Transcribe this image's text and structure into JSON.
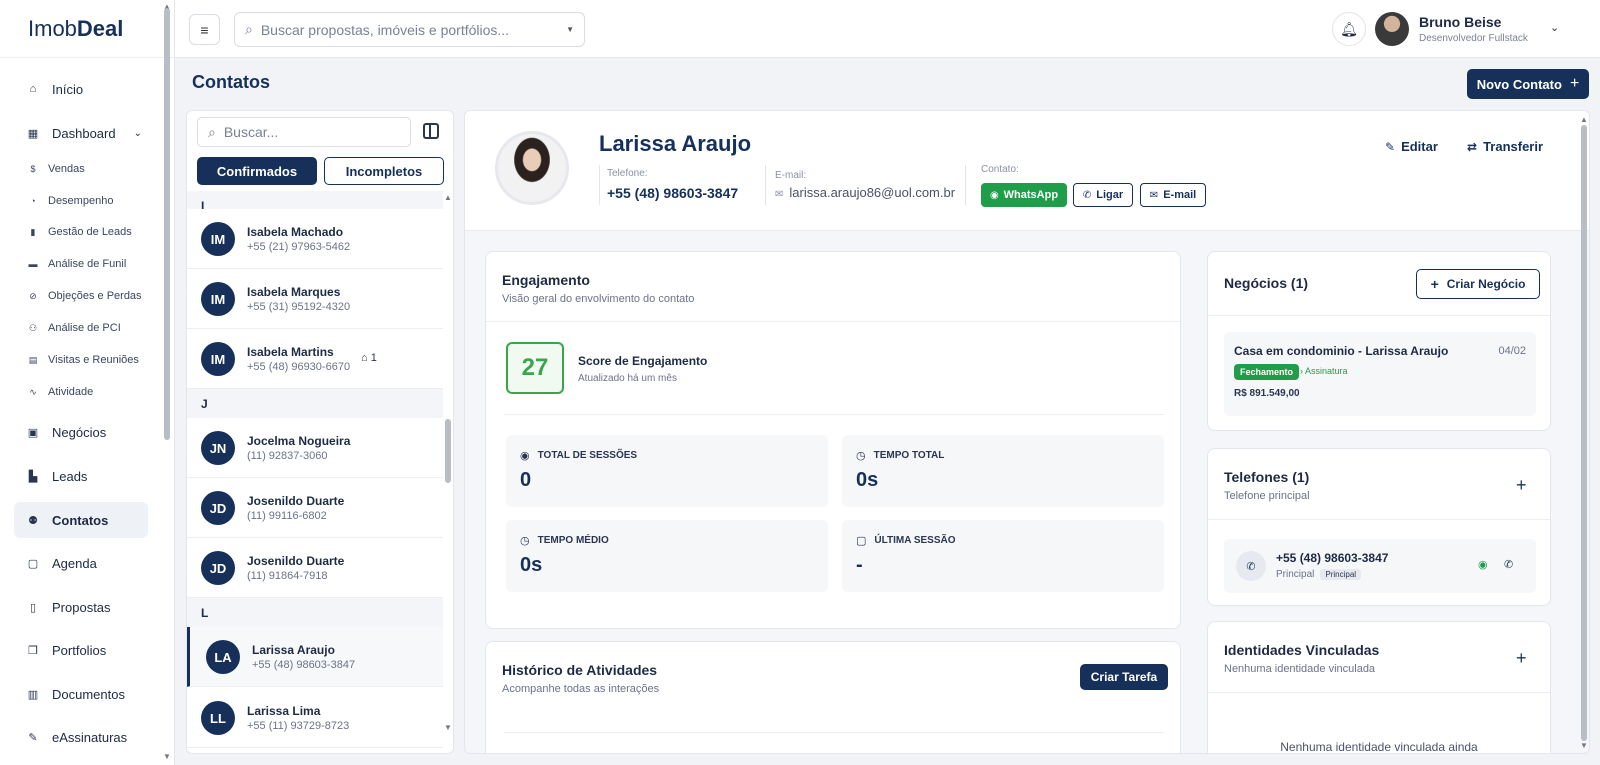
{
  "app": {
    "logo_light": "Imob",
    "logo_bold": "Deal"
  },
  "sidebar": {
    "items": [
      {
        "label": "Início",
        "icon": "home-icon"
      },
      {
        "label": "Dashboard",
        "icon": "grid-icon"
      },
      {
        "label": "Negócios",
        "icon": "briefcase-icon"
      },
      {
        "label": "Leads",
        "icon": "bar-chart-icon"
      },
      {
        "label": "Contatos",
        "icon": "users-icon"
      },
      {
        "label": "Agenda",
        "icon": "calendar-icon"
      },
      {
        "label": "Propostas",
        "icon": "file-icon"
      },
      {
        "label": "Portfolios",
        "icon": "copy-icon"
      },
      {
        "label": "Documentos",
        "icon": "pdf-icon"
      },
      {
        "label": "eAssinaturas",
        "icon": "signature-icon"
      }
    ],
    "dashboard_sub": [
      {
        "label": "Vendas",
        "icon": "dollar-icon"
      },
      {
        "label": "Desempenho",
        "icon": "gauge-icon"
      },
      {
        "label": "Gestão de Leads",
        "icon": "bars-icon"
      },
      {
        "label": "Análise de Funil",
        "icon": "funnel-icon"
      },
      {
        "label": "Objeções e Perdas",
        "icon": "ban-icon"
      },
      {
        "label": "Análise de PCI",
        "icon": "people-icon"
      },
      {
        "label": "Visitas e Reuniões",
        "icon": "building-icon"
      },
      {
        "label": "Atividade",
        "icon": "activity-icon"
      }
    ]
  },
  "topbar": {
    "search_placeholder": "Buscar propostas, imóveis e portfólios...",
    "user_name": "Bruno Beise",
    "user_role": "Desenvolvedor Fullstack"
  },
  "page": {
    "title": "Contatos",
    "new_button": "Novo Contato"
  },
  "contact_list": {
    "search_placeholder": "Buscar...",
    "tab_confirmed": "Confirmados",
    "tab_incomplete": "Incompletos",
    "groups": [
      {
        "letter": "I",
        "contacts": [
          {
            "initials": "IM",
            "name": "Isabela Machado",
            "phone": "+55 (21) 97963-5462"
          },
          {
            "initials": "IM",
            "name": "Isabela Marques",
            "phone": "+55 (31) 95192-4320"
          },
          {
            "initials": "IM",
            "name": "Isabela Martins",
            "phone": "+55 (48) 96930-6670",
            "badge": "1"
          }
        ]
      },
      {
        "letter": "J",
        "contacts": [
          {
            "initials": "JN",
            "name": "Jocelma Nogueira",
            "phone": "(11) 92837-3060"
          },
          {
            "initials": "JD",
            "name": "Josenildo Duarte",
            "phone": "(11) 99116-6802"
          },
          {
            "initials": "JD",
            "name": "Josenildo Duarte",
            "phone": "(11) 91864-7918"
          }
        ]
      },
      {
        "letter": "L",
        "contacts": [
          {
            "initials": "LA",
            "name": "Larissa Araujo",
            "phone": "+55 (48) 98603-3847"
          },
          {
            "initials": "LL",
            "name": "Larissa Lima",
            "phone": "+55 (11) 93729-8723"
          }
        ]
      }
    ]
  },
  "contact": {
    "name": "Larissa Araujo",
    "phone_label": "Telefone:",
    "phone": "+55 (48) 98603-3847",
    "email_label": "E-mail:",
    "email": "larissa.araujo86@uol.com.br",
    "contact_label": "Contato:",
    "btn_whatsapp": "WhatsApp",
    "btn_call": "Ligar",
    "btn_email": "E-mail",
    "edit": "Editar",
    "transfer": "Transferir"
  },
  "engagement": {
    "title": "Engajamento",
    "subtitle": "Visão geral do envolvimento do contato",
    "score": "27",
    "score_title": "Score de Engajamento",
    "score_updated": "Atualizado há um mês",
    "stats": [
      {
        "label": "TOTAL DE SESSÕES",
        "value": "0",
        "icon": "eye-icon"
      },
      {
        "label": "TEMPO TOTAL",
        "value": "0s",
        "icon": "clock-icon"
      },
      {
        "label": "TEMPO MÉDIO",
        "value": "0s",
        "icon": "clock-icon"
      },
      {
        "label": "ÚLTIMA SESSÃO",
        "value": "-",
        "icon": "calendar-icon"
      }
    ]
  },
  "history": {
    "title": "Histórico de Atividades",
    "subtitle": "Acompanhe todas as interações",
    "button": "Criar Tarefa"
  },
  "deals": {
    "title": "Negócios (1)",
    "button": "Criar Negócio",
    "items": [
      {
        "title": "Casa em condominio - Larissa Araujo",
        "date": "04/02",
        "stage": "Fechamento",
        "next_stage": "Assinatura",
        "value": "R$ 891.549,00"
      }
    ]
  },
  "phones": {
    "title": "Telefones (1)",
    "subtitle": "Telefone principal",
    "number": "+55 (48) 98603-3847",
    "type": "Principal",
    "tag": "Principal"
  },
  "identities": {
    "title": "Identidades Vinculadas",
    "subtitle": "Nenhuma identidade vinculada",
    "empty": "Nenhuma identidade vinculada ainda"
  },
  "colors": {
    "primary": "#16305a",
    "success": "#1f9e4a",
    "score": "#3aa54a"
  }
}
